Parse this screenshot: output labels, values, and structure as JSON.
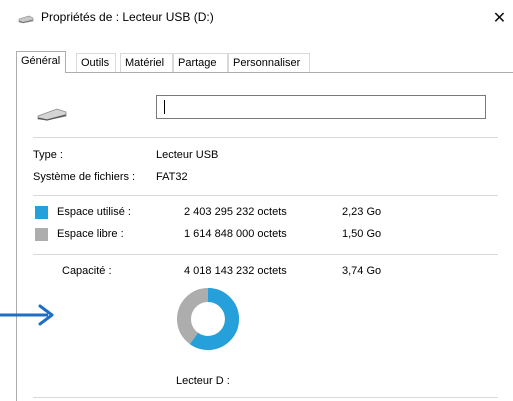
{
  "window": {
    "title": "Propriétés de : Lecteur USB (D:)",
    "close_symbol": "✕",
    "icons": {
      "title": "usb-drive-icon",
      "close": "close-icon"
    }
  },
  "tabs": [
    {
      "label": "Général",
      "active": true
    },
    {
      "label": "Outils",
      "active": false
    },
    {
      "label": "Matériel",
      "active": false
    },
    {
      "label": "Partage",
      "active": false
    },
    {
      "label": "Personnaliser",
      "active": false
    }
  ],
  "general": {
    "drive_name_value": "",
    "type_label": "Type :",
    "type_value": "Lecteur USB",
    "fs_label": "Système de fichiers :",
    "fs_value": "FAT32",
    "used": {
      "label": "Espace utilisé :",
      "bytes": "2 403 295 232 octets",
      "size": "2,23 Go",
      "color": "#26a0da"
    },
    "free": {
      "label": "Espace libre :",
      "bytes": "1 614 848 000 octets",
      "size": "1,50 Go",
      "color": "#adadad"
    },
    "capacity": {
      "label": "Capacité :",
      "bytes": "4 018 143 232 octets",
      "size": "3,74 Go"
    },
    "drive_label": "Lecteur D :"
  },
  "usage_fraction": 0.598,
  "annotation": {
    "arrow_color": "#1f6fc4",
    "icon": "arrow-right-icon"
  }
}
